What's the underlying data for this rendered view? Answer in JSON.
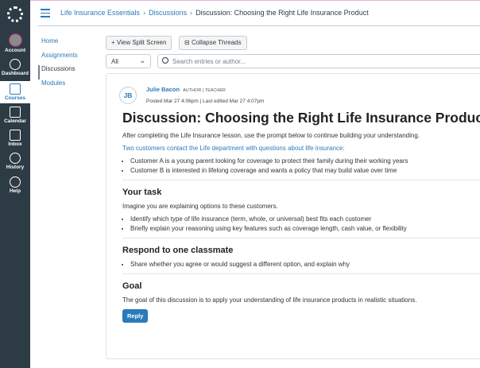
{
  "global_nav": [
    "Account",
    "Dashboard",
    "Courses",
    "Calendar",
    "Inbox",
    "History",
    "Help"
  ],
  "breadcrumb": [
    "Life Insurance Essentials",
    "Discussions",
    "Discussion: Choosing the Right Life Insurance Product"
  ],
  "course_nav": [
    "Home",
    "Assignments",
    "Discussions",
    "Modules"
  ],
  "toolbar": {
    "split": "View Split Screen",
    "collapse": "Collapse Threads",
    "filter": "All",
    "search_placeholder": "Search entries or author..."
  },
  "post": {
    "initials": "JB",
    "author": "Julie Bacon",
    "roles": "AUTHOR | TEACHER",
    "posted": "Posted Mar 27 4:06pm | Last edited Mar 27 4:07pm",
    "title": "Discussion: Choosing the Right Life Insurance Product",
    "intro": "After completing the Life Insurance lesson, use the prompt below to continue building your understanding.",
    "intro2": "Two customers contact the Life department with questions about life insurance:",
    "customers": [
      "Customer A is a young parent looking for coverage to protect their family during their working years",
      "Customer B is interested in lifelong coverage and wants a policy that may build value over time"
    ],
    "task_heading": "Your task",
    "task_text": "Imagine you are explaining options to these customers.",
    "task_items": [
      "Identify which type of life insurance (term, whole, or universal) best fits each customer",
      "Briefly explain your reasoning using key features such as coverage length, cash value, or flexibility"
    ],
    "respond_heading": "Respond to one classmate",
    "respond_items": [
      "Share whether you agree or would suggest a different option, and explain why"
    ],
    "goal_heading": "Goal",
    "goal_text": "The goal of this discussion is to apply your understanding of life insurance products in realistic situations.",
    "reply": "Reply"
  }
}
